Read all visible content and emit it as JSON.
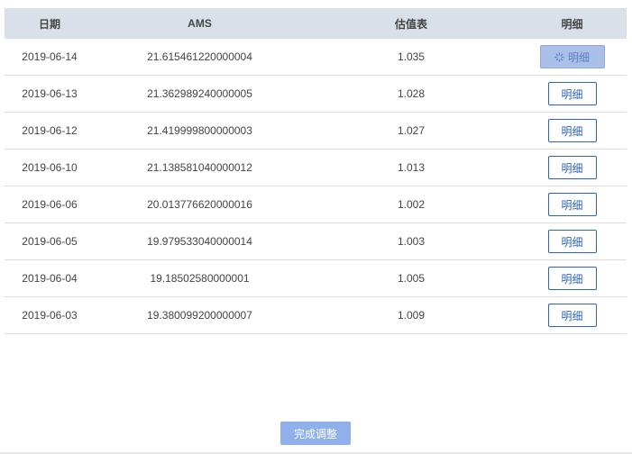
{
  "table": {
    "headers": {
      "date": "日期",
      "ams": "AMS",
      "valuation": "估值表",
      "detail": "明细"
    },
    "rows": [
      {
        "date": "2019-06-14",
        "ams": "21.615461220000004",
        "valuation": "1.035",
        "detail": "明细",
        "loading": true
      },
      {
        "date": "2019-06-13",
        "ams": "21.362989240000005",
        "valuation": "1.028",
        "detail": "明细"
      },
      {
        "date": "2019-06-12",
        "ams": "21.419999800000003",
        "valuation": "1.027",
        "detail": "明细"
      },
      {
        "date": "2019-06-10",
        "ams": "21.138581040000012",
        "valuation": "1.013",
        "detail": "明细"
      },
      {
        "date": "2019-06-06",
        "ams": "20.013776620000016",
        "valuation": "1.002",
        "detail": "明细"
      },
      {
        "date": "2019-06-05",
        "ams": "19.979533040000014",
        "valuation": "1.003",
        "detail": "明细"
      },
      {
        "date": "2019-06-04",
        "ams": "19.18502580000001",
        "valuation": "1.005",
        "detail": "明细"
      },
      {
        "date": "2019-06-03",
        "ams": "19.380099200000007",
        "valuation": "1.009",
        "detail": "明细"
      }
    ]
  },
  "footer": {
    "complete_label": "完成调整"
  },
  "colors": {
    "header_bg": "#d9e0ea",
    "button_border": "#2f64b4",
    "primary_disabled": "#8fb0ea"
  },
  "icons": {
    "loading": "spinner-icon"
  }
}
